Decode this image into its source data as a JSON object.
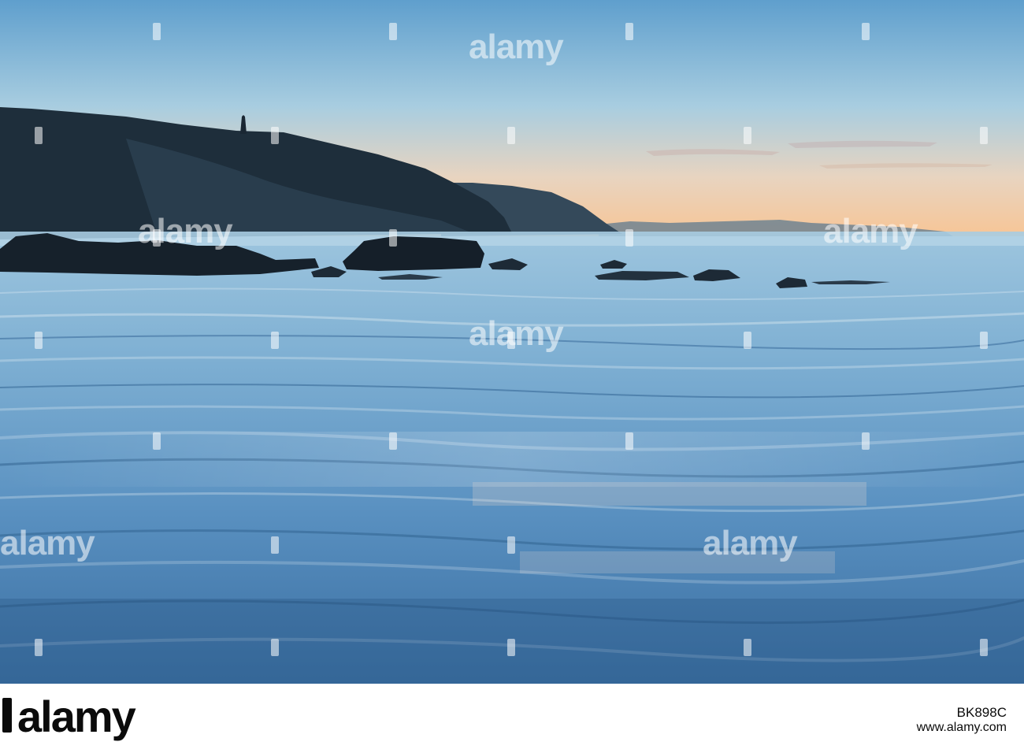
{
  "photo": {
    "subject": "",
    "colors": {
      "sky_top": "#5a9ccb",
      "sky_mid": "#a9cde0",
      "sky_horizon": "#f6c89c",
      "cliff": "#1f2f3d",
      "cliff_far": "#3e5566",
      "sea": "#7fb3d6",
      "sand_wet": "#4d86b8",
      "sand_dark": "#2c5d8e",
      "rock": "#15202a"
    }
  },
  "watermarks": {
    "text": "alamy",
    "icon": "alamy-mark-icon"
  },
  "footer": {
    "brand": "alamy",
    "brand_icon": "alamy-logo-icon",
    "stock_id": "BK898C",
    "url": "www.alamy.com"
  }
}
